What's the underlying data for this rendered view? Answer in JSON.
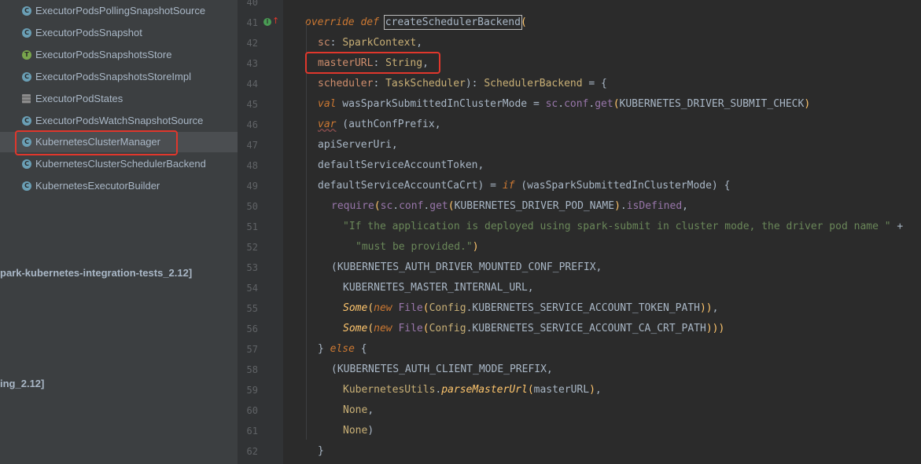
{
  "sidebar": {
    "items": [
      {
        "label": "ExecutorPodsPollingSnapshotSource",
        "icon": "class-icon",
        "icon_glyph": "C"
      },
      {
        "label": "ExecutorPodsSnapshot",
        "icon": "class-icon",
        "icon_glyph": "C"
      },
      {
        "label": "ExecutorPodsSnapshotsStore",
        "icon": "trait-icon",
        "icon_glyph": "T"
      },
      {
        "label": "ExecutorPodsSnapshotsStoreImpl",
        "icon": "class-icon",
        "icon_glyph": "C"
      },
      {
        "label": "ExecutorPodStates",
        "icon": "multi-file-icon",
        "icon_glyph": ""
      },
      {
        "label": "ExecutorPodsWatchSnapshotSource",
        "icon": "class-icon",
        "icon_glyph": "C"
      },
      {
        "label": "KubernetesClusterManager",
        "icon": "class-icon",
        "icon_glyph": "C"
      },
      {
        "label": "KubernetesClusterSchedulerBackend",
        "icon": "class-icon",
        "icon_glyph": "C"
      },
      {
        "label": "KubernetesExecutorBuilder",
        "icon": "class-icon",
        "icon_glyph": "C"
      }
    ],
    "selected_index": 6,
    "modules": [
      {
        "label": "park-kubernetes-integration-tests_2.12]"
      },
      {
        "label": "ing_2.12]"
      }
    ]
  },
  "editor": {
    "lines": [
      {
        "no": "40",
        "tokens": []
      },
      {
        "no": "41",
        "tokens": [
          [
            "kwi",
            "override"
          ],
          [
            "plain",
            " "
          ],
          [
            "kwi",
            "def"
          ],
          [
            "plain",
            " "
          ],
          [
            "sel",
            "createSchedulerBackend"
          ],
          [
            "fn",
            "("
          ]
        ]
      },
      {
        "no": "42",
        "tokens": [
          [
            "param",
            "sc"
          ],
          [
            "plain",
            ": "
          ],
          [
            "type",
            "SparkContext"
          ],
          [
            "plain",
            ","
          ]
        ]
      },
      {
        "no": "43",
        "tokens": [
          [
            "param",
            "masterURL"
          ],
          [
            "plain",
            ": "
          ],
          [
            "type",
            "String"
          ],
          [
            "plain",
            ","
          ]
        ]
      },
      {
        "no": "44",
        "tokens": [
          [
            "param",
            "scheduler"
          ],
          [
            "plain",
            ": "
          ],
          [
            "type",
            "TaskScheduler"
          ],
          [
            "plain",
            "): "
          ],
          [
            "type",
            "SchedulerBackend"
          ],
          [
            "plain",
            " = {"
          ]
        ]
      },
      {
        "no": "45",
        "tokens": [
          [
            "kwi",
            "val"
          ],
          [
            "plain",
            " wasSparkSubmittedInClusterMode = "
          ],
          [
            "field",
            "sc"
          ],
          [
            "plain",
            "."
          ],
          [
            "field",
            "conf"
          ],
          [
            "plain",
            "."
          ],
          [
            "field",
            "get"
          ],
          [
            "fn",
            "("
          ],
          [
            "plain",
            "KUBERNETES_DRIVER_SUBMIT_CHECK"
          ],
          [
            "fn",
            ")"
          ]
        ]
      },
      {
        "no": "46",
        "tokens": [
          [
            "kwisq",
            "var"
          ],
          [
            "plain",
            " (authConfPrefix,"
          ]
        ]
      },
      {
        "no": "47",
        "tokens": [
          [
            "plain",
            "apiServerUri,"
          ]
        ]
      },
      {
        "no": "48",
        "tokens": [
          [
            "plain",
            "defaultServiceAccountToken,"
          ]
        ]
      },
      {
        "no": "49",
        "tokens": [
          [
            "plain",
            "defaultServiceAccountCaCrt) = "
          ],
          [
            "kwi",
            "if"
          ],
          [
            "plain",
            " (wasSparkSubmittedInClusterMode) {"
          ]
        ]
      },
      {
        "no": "50",
        "tokens": [
          [
            "field",
            "require"
          ],
          [
            "fn",
            "("
          ],
          [
            "field",
            "sc"
          ],
          [
            "plain",
            "."
          ],
          [
            "field",
            "conf"
          ],
          [
            "plain",
            "."
          ],
          [
            "field",
            "get"
          ],
          [
            "fn",
            "("
          ],
          [
            "plain",
            "KUBERNETES_DRIVER_POD_NAME"
          ],
          [
            "fn",
            ")"
          ],
          [
            "plain",
            "."
          ],
          [
            "field",
            "isDefined"
          ],
          [
            "plain",
            ","
          ]
        ]
      },
      {
        "no": "51",
        "tokens": [
          [
            "str",
            "\"If the application is deployed using spark-submit in cluster mode, the driver pod name \""
          ],
          [
            "plain",
            " +"
          ]
        ]
      },
      {
        "no": "52",
        "tokens": [
          [
            "str",
            "\"must be provided.\""
          ],
          [
            "fn",
            ")"
          ]
        ]
      },
      {
        "no": "53",
        "tokens": [
          [
            "plain",
            "(KUBERNETES_AUTH_DRIVER_MOUNTED_CONF_PREFIX,"
          ]
        ]
      },
      {
        "no": "54",
        "tokens": [
          [
            "plain",
            "KUBERNETES_MASTER_INTERNAL_URL,"
          ]
        ]
      },
      {
        "no": "55",
        "tokens": [
          [
            "fni",
            "Some"
          ],
          [
            "fn",
            "("
          ],
          [
            "kwi",
            "new"
          ],
          [
            "plain",
            " "
          ],
          [
            "field",
            "File"
          ],
          [
            "fn",
            "("
          ],
          [
            "type",
            "Config"
          ],
          [
            "plain",
            ".KUBERNETES_SERVICE_ACCOUNT_TOKEN_PATH"
          ],
          [
            "fn",
            "))"
          ],
          [
            "plain",
            ","
          ]
        ]
      },
      {
        "no": "56",
        "tokens": [
          [
            "fni",
            "Some"
          ],
          [
            "fn",
            "("
          ],
          [
            "kwi",
            "new"
          ],
          [
            "plain",
            " "
          ],
          [
            "field",
            "File"
          ],
          [
            "fn",
            "("
          ],
          [
            "type",
            "Config"
          ],
          [
            "plain",
            ".KUBERNETES_SERVICE_ACCOUNT_CA_CRT_PATH"
          ],
          [
            "fn",
            ")))"
          ]
        ]
      },
      {
        "no": "57",
        "tokens": [
          [
            "plain",
            "} "
          ],
          [
            "kwi",
            "else"
          ],
          [
            "plain",
            " {"
          ]
        ]
      },
      {
        "no": "58",
        "tokens": [
          [
            "plain",
            "(KUBERNETES_AUTH_CLIENT_MODE_PREFIX,"
          ]
        ]
      },
      {
        "no": "59",
        "tokens": [
          [
            "type",
            "KubernetesUtils"
          ],
          [
            "plain",
            "."
          ],
          [
            "fni",
            "parseMasterUrl"
          ],
          [
            "fn",
            "("
          ],
          [
            "plain",
            "masterURL"
          ],
          [
            "fn",
            ")"
          ],
          [
            "plain",
            ","
          ]
        ]
      },
      {
        "no": "60",
        "tokens": [
          [
            "type",
            "None"
          ],
          [
            "plain",
            ","
          ]
        ]
      },
      {
        "no": "61",
        "tokens": [
          [
            "type",
            "None"
          ],
          [
            "plain",
            ")"
          ]
        ]
      },
      {
        "no": "62",
        "tokens": [
          [
            "plain",
            "}"
          ]
        ]
      }
    ]
  }
}
